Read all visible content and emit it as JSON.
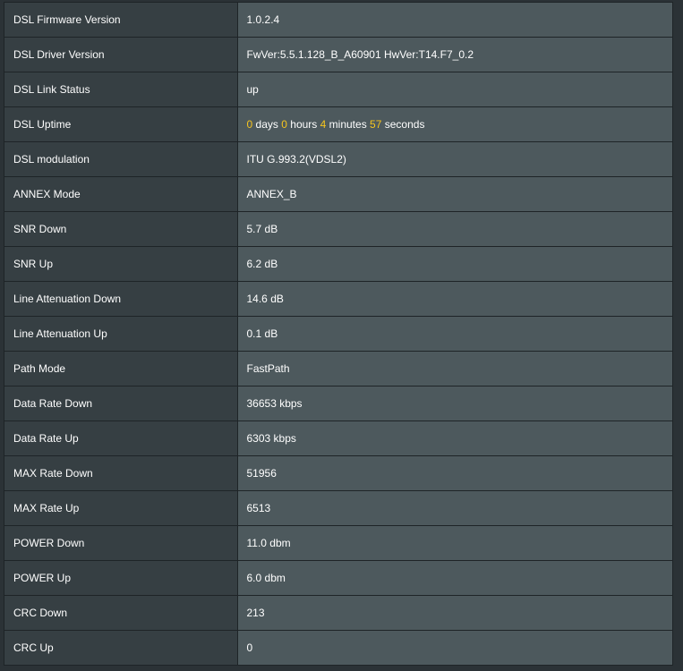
{
  "accent_color": "#f5c41e",
  "rows": [
    {
      "label": "DSL Firmware Version",
      "value": "1.0.2.4"
    },
    {
      "label": "DSL Driver Version",
      "value": "FwVer:5.5.1.128_B_A60901 HwVer:T14.F7_0.2"
    },
    {
      "label": "DSL Link Status",
      "value": "up"
    },
    {
      "label": "DSL Uptime",
      "value": ""
    },
    {
      "label": "DSL modulation",
      "value": "ITU G.993.2(VDSL2)"
    },
    {
      "label": "ANNEX Mode",
      "value": "ANNEX_B"
    },
    {
      "label": "SNR Down",
      "value": "5.7 dB"
    },
    {
      "label": "SNR Up",
      "value": "6.2 dB"
    },
    {
      "label": "Line Attenuation Down",
      "value": "14.6 dB"
    },
    {
      "label": "Line Attenuation Up",
      "value": "0.1 dB"
    },
    {
      "label": "Path Mode",
      "value": "FastPath"
    },
    {
      "label": "Data Rate Down",
      "value": "36653 kbps"
    },
    {
      "label": "Data Rate Up",
      "value": "6303 kbps"
    },
    {
      "label": "MAX Rate Down",
      "value": "51956"
    },
    {
      "label": "MAX Rate Up",
      "value": "6513"
    },
    {
      "label": "POWER Down",
      "value": "11.0 dbm"
    },
    {
      "label": "POWER Up",
      "value": "6.0 dbm"
    },
    {
      "label": "CRC Down",
      "value": "213"
    },
    {
      "label": "CRC Up",
      "value": "0"
    }
  ],
  "uptime": {
    "days": "0",
    "days_unit": "days",
    "hours": "0",
    "hours_unit": "hours",
    "minutes": "4",
    "minutes_unit": "minutes",
    "seconds": "57",
    "seconds_unit": "seconds"
  }
}
